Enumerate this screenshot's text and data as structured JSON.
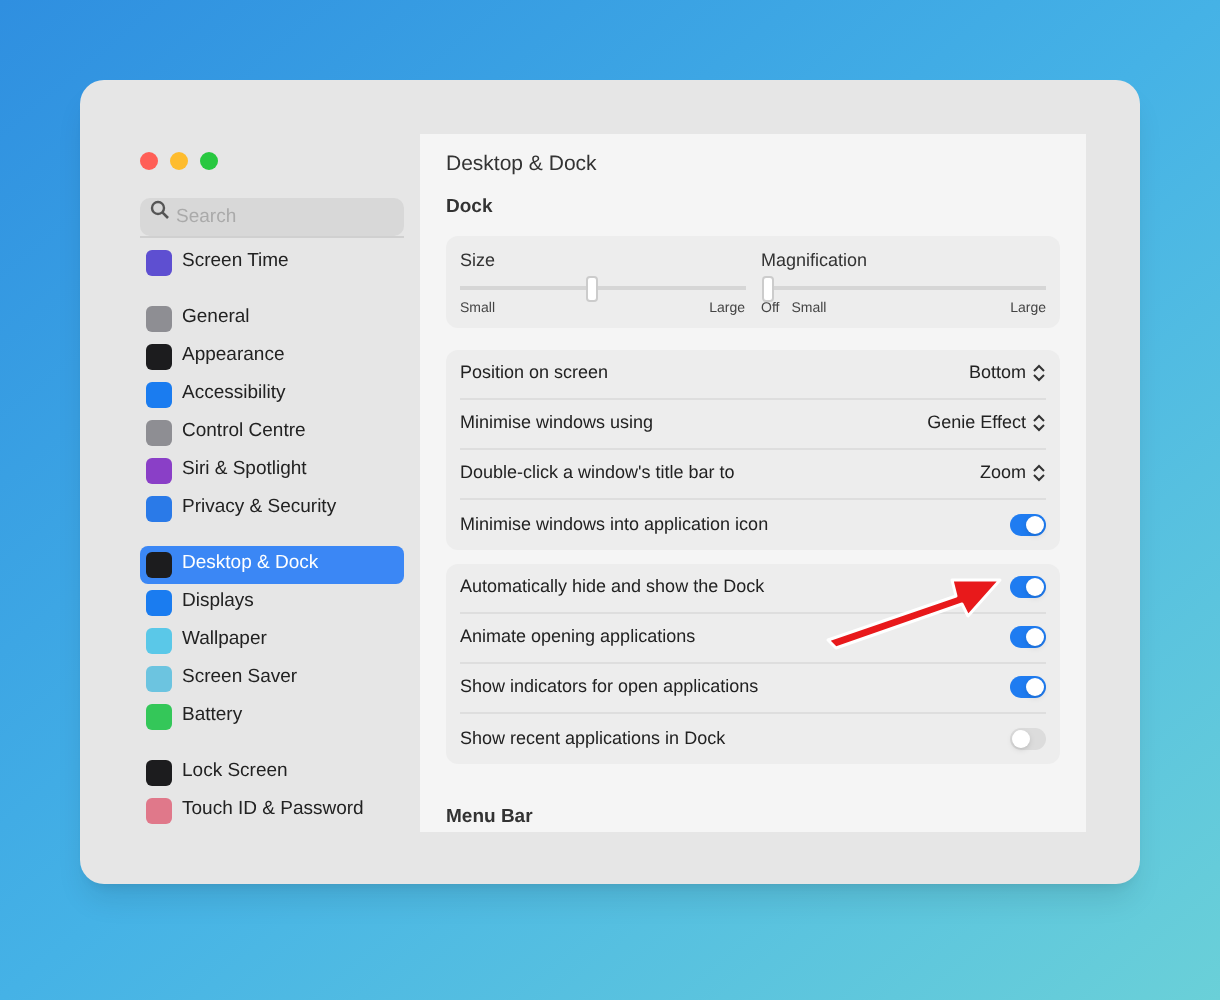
{
  "window": {
    "title": "Desktop & Dock"
  },
  "search": {
    "placeholder": "Search"
  },
  "sidebar": {
    "groups": [
      [
        {
          "label": "Screen Time",
          "color": "#5e4fd1",
          "selected": false
        }
      ],
      [
        {
          "label": "General",
          "color": "#8e8e93",
          "selected": false
        },
        {
          "label": "Appearance",
          "color": "#1c1c1e",
          "selected": false
        },
        {
          "label": "Accessibility",
          "color": "#1a7cf0",
          "selected": false
        },
        {
          "label": "Control Centre",
          "color": "#8e8e93",
          "selected": false
        },
        {
          "label": "Siri & Spotlight",
          "color": "#8a3fc7",
          "selected": false
        },
        {
          "label": "Privacy & Security",
          "color": "#2a7ae8",
          "selected": false
        }
      ],
      [
        {
          "label": "Desktop & Dock",
          "color": "#1c1c1e",
          "selected": true
        },
        {
          "label": "Displays",
          "color": "#1a7cf0",
          "selected": false
        },
        {
          "label": "Wallpaper",
          "color": "#5ac8e8",
          "selected": false
        },
        {
          "label": "Screen Saver",
          "color": "#6cc4e0",
          "selected": false
        },
        {
          "label": "Battery",
          "color": "#34c759",
          "selected": false
        }
      ],
      [
        {
          "label": "Lock Screen",
          "color": "#1c1c1e",
          "selected": false
        },
        {
          "label": "Touch ID & Password",
          "color": "#e0788a",
          "selected": false
        }
      ]
    ]
  },
  "section": {
    "title": "Dock"
  },
  "sliders": [
    {
      "label": "Size",
      "level": 0.46,
      "min_label": "Small",
      "max_label": "Large"
    },
    {
      "label": "Magnification",
      "level": 0,
      "off_label": "Off",
      "min_label": "Small",
      "max_label": "Large"
    }
  ],
  "groups": [
    [
      {
        "kind": "popup",
        "label": "Position on screen",
        "value": "Bottom"
      },
      {
        "kind": "popup",
        "label": "Minimise windows using",
        "value": "Genie Effect"
      },
      {
        "kind": "popup",
        "label": "Double-click a window's title bar to",
        "value": "Zoom"
      },
      {
        "kind": "toggle",
        "label": "Minimise windows into application icon",
        "on": true
      }
    ],
    [
      {
        "kind": "toggle",
        "label": "Automatically hide and show the Dock",
        "on": true
      },
      {
        "kind": "toggle",
        "label": "Animate opening applications",
        "on": true
      },
      {
        "kind": "toggle",
        "label": "Show indicators for open applications",
        "on": true
      },
      {
        "kind": "toggle",
        "label": "Show recent applications in Dock",
        "on": false
      }
    ]
  ],
  "next_section": {
    "title": "Menu Bar"
  }
}
